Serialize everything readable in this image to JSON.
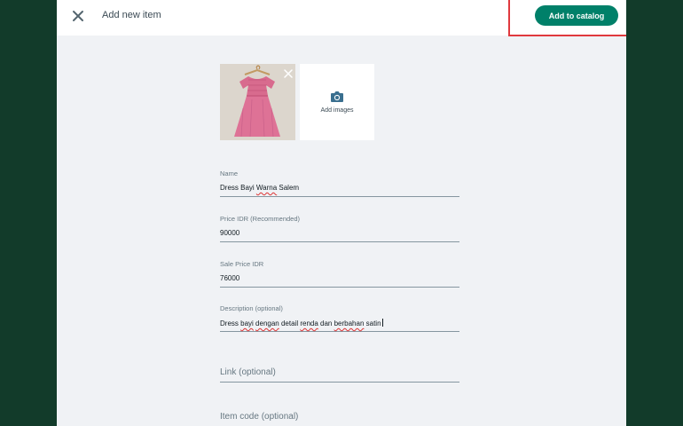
{
  "header": {
    "title": "Add new item",
    "add_button_label": "Add to catalog"
  },
  "media": {
    "add_images_label": "Add images"
  },
  "fields": {
    "name": {
      "label": "Name",
      "value_parts": [
        "Dress Bayi ",
        "Warna",
        " Salem"
      ]
    },
    "price": {
      "label": "Price IDR (Recommended)",
      "value": "90000"
    },
    "sale_price": {
      "label": "Sale Price IDR",
      "value": "76000"
    },
    "description": {
      "label": "Description (optional)",
      "value_parts": [
        "Dress ",
        "bayi",
        " ",
        "dengan",
        " detail ",
        "renda",
        " dan ",
        "berbahan",
        " satin"
      ]
    },
    "link": {
      "placeholder": "Link (optional)"
    },
    "item_code": {
      "placeholder": "Item code (optional)"
    }
  },
  "colors": {
    "backdrop": "#123b2a",
    "accent": "#008069",
    "highlight": "#e0393e"
  },
  "icons": {
    "close": "close-icon",
    "remove_image": "close-icon",
    "camera": "camera-icon"
  }
}
